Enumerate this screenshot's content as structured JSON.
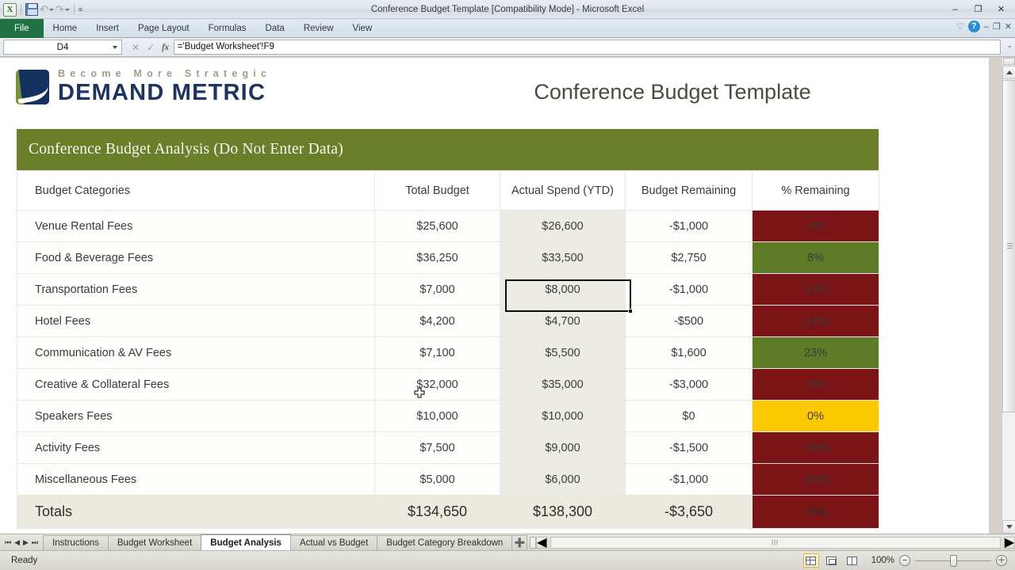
{
  "window": {
    "title": "Conference Budget Template  [Compatibility Mode]  -  Microsoft Excel",
    "minimize": "–",
    "restore": "❐",
    "close": "✕"
  },
  "qat": {
    "app_icon": "X",
    "save": "save-icon",
    "undo": "↶",
    "redo": "↷",
    "customize": "≡"
  },
  "ribbon": {
    "tabs": [
      {
        "label": "File"
      },
      {
        "label": "Home"
      },
      {
        "label": "Insert"
      },
      {
        "label": "Page Layout"
      },
      {
        "label": "Formulas"
      },
      {
        "label": "Data"
      },
      {
        "label": "Review"
      },
      {
        "label": "View"
      }
    ],
    "right": {
      "minimize_ribbon": "♡",
      "help": "?",
      "win_min": "–",
      "win_restore": "❐",
      "win_close": "✕"
    }
  },
  "formula_bar": {
    "name_box": "D4",
    "cancel": "✕",
    "accept": "✓",
    "fx": "fx",
    "formula": "='Budget Worksheet'!F9",
    "expand": "⌄"
  },
  "document": {
    "logo_tagline": "Become More Strategic",
    "logo_name": "DEMAND METRIC",
    "title": "Conference Budget Template",
    "banner": "Conference Budget Analysis (Do Not Enter Data)"
  },
  "table": {
    "headers": [
      "Budget Categories",
      "Total Budget",
      "Actual Spend (YTD)",
      "Budget Remaining",
      "% Remaining"
    ],
    "rows": [
      {
        "category": "Venue Rental Fees",
        "total_budget": "$25,600",
        "actual_spend": "$26,600",
        "remaining": "-$1,000",
        "pct": "-4%",
        "pct_color": "#7a1416"
      },
      {
        "category": "Food & Beverage Fees",
        "total_budget": "$36,250",
        "actual_spend": "$33,500",
        "remaining": "$2,750",
        "pct": "8%",
        "pct_color": "#5e7c28"
      },
      {
        "category": "Transportation Fees",
        "total_budget": "$7,000",
        "actual_spend": "$8,000",
        "remaining": "-$1,000",
        "pct": "-14%",
        "pct_color": "#7a1416"
      },
      {
        "category": "Hotel Fees",
        "total_budget": "$4,200",
        "actual_spend": "$4,700",
        "remaining": "-$500",
        "pct": "-12%",
        "pct_color": "#7a1416"
      },
      {
        "category": "Communication & AV Fees",
        "total_budget": "$7,100",
        "actual_spend": "$5,500",
        "remaining": "$1,600",
        "pct": "23%",
        "pct_color": "#5e7c28"
      },
      {
        "category": "Creative & Collateral Fees",
        "total_budget": "$32,000",
        "actual_spend": "$35,000",
        "remaining": "-$3,000",
        "pct": "-9%",
        "pct_color": "#7a1416"
      },
      {
        "category": "Speakers Fees",
        "total_budget": "$10,000",
        "actual_spend": "$10,000",
        "remaining": "$0",
        "pct": "0%",
        "pct_color": "#fcc900"
      },
      {
        "category": "Activity Fees",
        "total_budget": "$7,500",
        "actual_spend": "$9,000",
        "remaining": "-$1,500",
        "pct": "-20%",
        "pct_color": "#7a1416"
      },
      {
        "category": "Miscellaneous Fees",
        "total_budget": "$5,000",
        "actual_spend": "$6,000",
        "remaining": "-$1,000",
        "pct": "-20%",
        "pct_color": "#7a1416"
      }
    ],
    "totals": {
      "label": "Totals",
      "total_budget": "$134,650",
      "actual_spend": "$138,300",
      "remaining": "-$3,650",
      "pct": "-3%",
      "pct_color": "#7a1416"
    }
  },
  "sheet_tabs": {
    "nav": {
      "first": "⏮",
      "prev": "◀",
      "next": "▶",
      "last": "⏭"
    },
    "tabs": [
      {
        "label": "Instructions",
        "active": false
      },
      {
        "label": "Budget Worksheet",
        "active": false
      },
      {
        "label": "Budget Analysis",
        "active": true
      },
      {
        "label": "Actual vs Budget",
        "active": false
      },
      {
        "label": "Budget Category Breakdown",
        "active": false
      }
    ],
    "new_sheet": "➕",
    "scroll_left": "◀",
    "scroll_right": "▶"
  },
  "status_bar": {
    "state": "Ready",
    "views": [
      "normal-view",
      "page-layout-view",
      "page-break-view"
    ],
    "zoom": "100%",
    "zoom_out": "−",
    "zoom_in": "＋"
  }
}
